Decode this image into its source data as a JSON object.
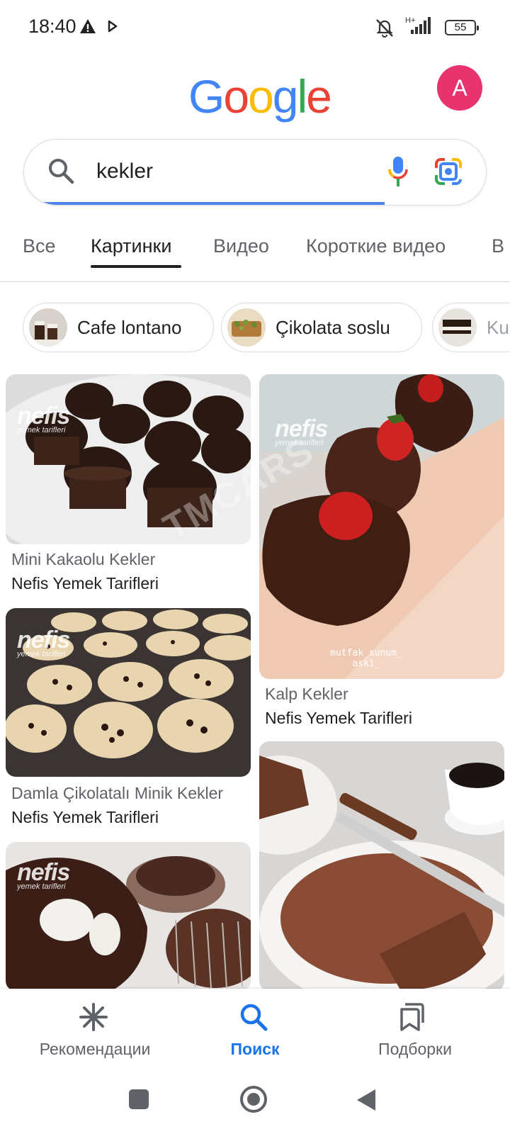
{
  "status_bar": {
    "time": "18:40",
    "network": "H+",
    "battery": "55",
    "icons": [
      "warning-icon",
      "play-icon",
      "mute-icon",
      "signal-icon",
      "battery-icon"
    ]
  },
  "header": {
    "logo": [
      "G",
      "o",
      "o",
      "g",
      "l",
      "e"
    ],
    "logo_colors": [
      "#4285F4",
      "#EA4335",
      "#FBBC05",
      "#4285F4",
      "#34A853",
      "#EA4335"
    ],
    "avatar_letter": "A",
    "avatar_color": "#e8336f"
  },
  "search": {
    "query": "kekler",
    "progress": 0.78
  },
  "tabs": [
    {
      "label": "Все"
    },
    {
      "label": "Картинки",
      "active": true
    },
    {
      "label": "Видео"
    },
    {
      "label": "Короткие видео"
    },
    {
      "label": "В"
    }
  ],
  "chips": [
    {
      "label": "Cafe lontano"
    },
    {
      "label": "Çikolata soslu"
    },
    {
      "label": "Ku"
    }
  ],
  "results": [
    {
      "title": "Mini Kakaolu Kekler",
      "source": "Nefis Yemek Tarifleri"
    },
    {
      "title": "Kalp Kekler",
      "source": "Nefis Yemek Tarifleri"
    },
    {
      "title": "Damla Çikolatalı Minik Kekler",
      "source": "Nefis Yemek Tarifleri"
    }
  ],
  "watermark": {
    "brand": "nefis",
    "sub": "yemek tarifleri",
    "caption": "mutfak_sunum_ aski_",
    "overlay": "TMCARS"
  },
  "bottom_nav": [
    {
      "label": "Рекомендации",
      "icon": "asterisk-icon"
    },
    {
      "label": "Поиск",
      "icon": "search-icon",
      "active": true
    },
    {
      "label": "Подборки",
      "icon": "collections-icon"
    }
  ],
  "accent_color": "#1a73e8"
}
